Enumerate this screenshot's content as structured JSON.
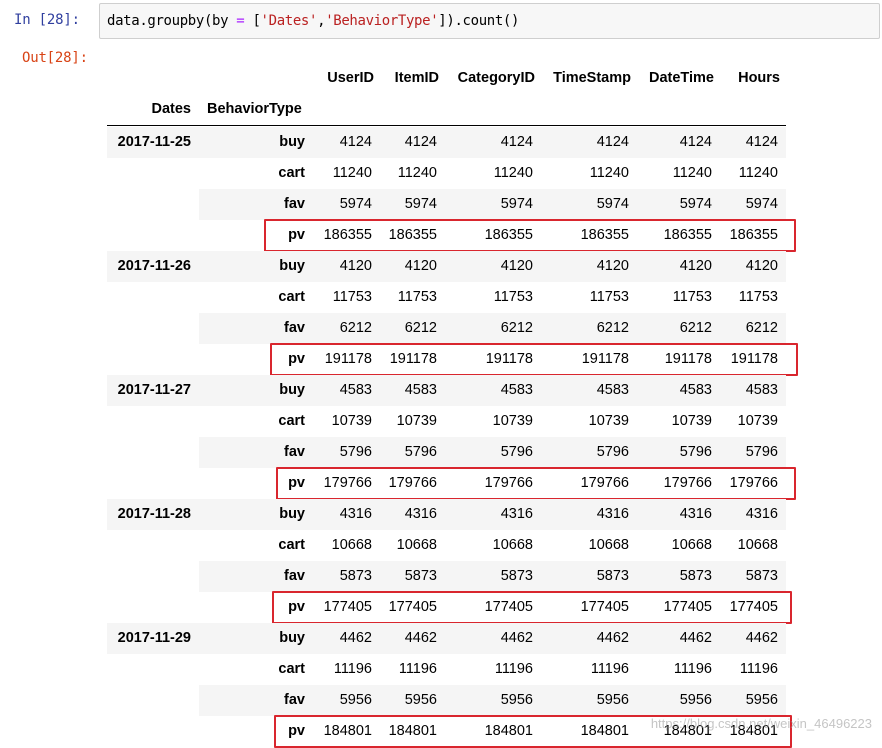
{
  "prompt_in": "In  [28]:",
  "prompt_out": "Out[28]:",
  "code": {
    "segments": [
      {
        "text": "data.groupby(by ",
        "cls": "punc"
      },
      {
        "text": "=",
        "cls": "op"
      },
      {
        "text": " [",
        "cls": "punc"
      },
      {
        "text": "'Dates'",
        "cls": "str"
      },
      {
        "text": ",",
        "cls": "punc"
      },
      {
        "text": "'BehaviorType'",
        "cls": "str"
      },
      {
        "text": "]).count()",
        "cls": "punc"
      }
    ]
  },
  "table": {
    "columns": [
      "UserID",
      "ItemID",
      "CategoryID",
      "TimeStamp",
      "DateTime",
      "Hours"
    ],
    "index_names": [
      "Dates",
      "BehaviorType"
    ],
    "groups": [
      {
        "date": "2017-11-25",
        "rows": [
          {
            "type": "buy",
            "values": [
              4124,
              4124,
              4124,
              4124,
              4124,
              4124
            ]
          },
          {
            "type": "cart",
            "values": [
              11240,
              11240,
              11240,
              11240,
              11240,
              11240
            ]
          },
          {
            "type": "fav",
            "values": [
              5974,
              5974,
              5974,
              5974,
              5974,
              5974
            ]
          },
          {
            "type": "pv",
            "values": [
              186355,
              186355,
              186355,
              186355,
              186355,
              186355
            ]
          }
        ]
      },
      {
        "date": "2017-11-26",
        "rows": [
          {
            "type": "buy",
            "values": [
              4120,
              4120,
              4120,
              4120,
              4120,
              4120
            ]
          },
          {
            "type": "cart",
            "values": [
              11753,
              11753,
              11753,
              11753,
              11753,
              11753
            ]
          },
          {
            "type": "fav",
            "values": [
              6212,
              6212,
              6212,
              6212,
              6212,
              6212
            ]
          },
          {
            "type": "pv",
            "values": [
              191178,
              191178,
              191178,
              191178,
              191178,
              191178
            ]
          }
        ]
      },
      {
        "date": "2017-11-27",
        "rows": [
          {
            "type": "buy",
            "values": [
              4583,
              4583,
              4583,
              4583,
              4583,
              4583
            ]
          },
          {
            "type": "cart",
            "values": [
              10739,
              10739,
              10739,
              10739,
              10739,
              10739
            ]
          },
          {
            "type": "fav",
            "values": [
              5796,
              5796,
              5796,
              5796,
              5796,
              5796
            ]
          },
          {
            "type": "pv",
            "values": [
              179766,
              179766,
              179766,
              179766,
              179766,
              179766
            ]
          }
        ]
      },
      {
        "date": "2017-11-28",
        "rows": [
          {
            "type": "buy",
            "values": [
              4316,
              4316,
              4316,
              4316,
              4316,
              4316
            ]
          },
          {
            "type": "cart",
            "values": [
              10668,
              10668,
              10668,
              10668,
              10668,
              10668
            ]
          },
          {
            "type": "fav",
            "values": [
              5873,
              5873,
              5873,
              5873,
              5873,
              5873
            ]
          },
          {
            "type": "pv",
            "values": [
              177405,
              177405,
              177405,
              177405,
              177405,
              177405
            ]
          }
        ]
      },
      {
        "date": "2017-11-29",
        "rows": [
          {
            "type": "buy",
            "values": [
              4462,
              4462,
              4462,
              4462,
              4462,
              4462
            ]
          },
          {
            "type": "cart",
            "values": [
              11196,
              11196,
              11196,
              11196,
              11196,
              11196
            ]
          },
          {
            "type": "fav",
            "values": [
              5956,
              5956,
              5956,
              5956,
              5956,
              5956
            ]
          },
          {
            "type": "pv",
            "values": [
              184801,
              184801,
              184801,
              184801,
              184801,
              184801
            ]
          }
        ]
      }
    ],
    "highlighted_type": "pv"
  },
  "colors": {
    "highlight_border": "#d9262e",
    "stripe": "#f5f5f5",
    "prompt_in": "#303f9f",
    "prompt_out": "#d84315"
  },
  "watermark": "https://blog.csdn.net/weixin_46496223"
}
